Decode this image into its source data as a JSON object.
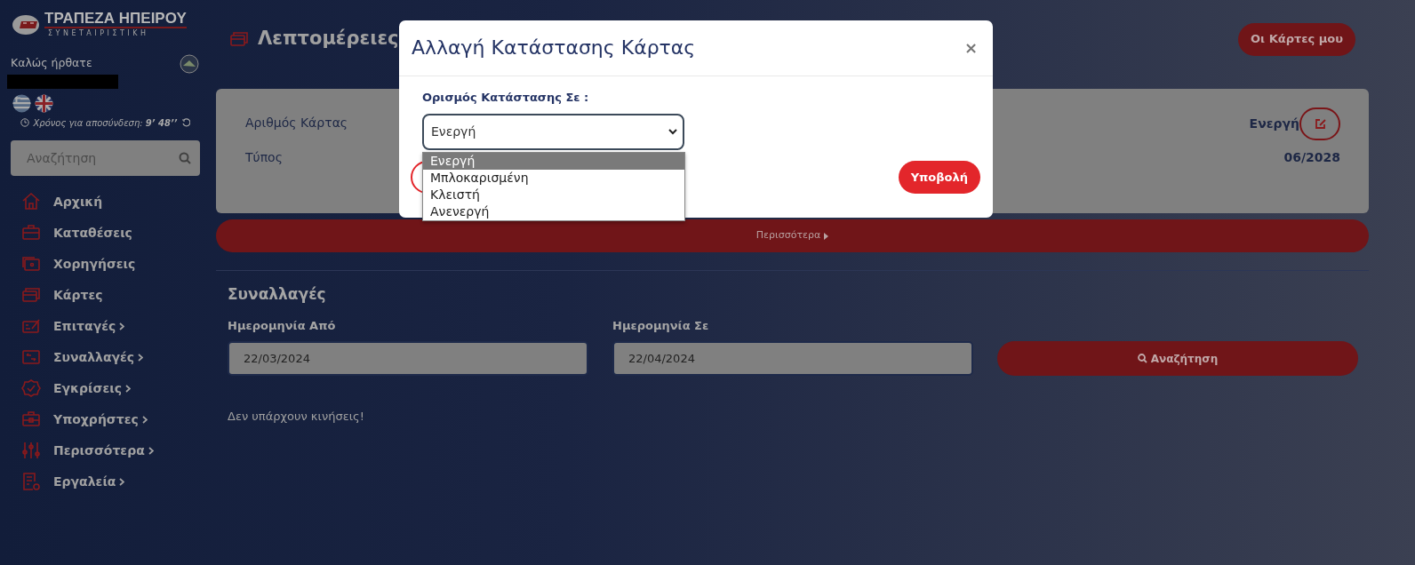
{
  "sidebar": {
    "logo": {
      "name": "ΤΡΑΠΕΖΑ ΗΠΕΙΡΟΥ",
      "tagline": "ΣΥΝΕΤΑΙΡΙΣΤΙΚΗ"
    },
    "welcome": "Καλώς ήρθατε",
    "session": "Χρόνος για αποσύνδεση: **9’ 48’’**",
    "search": {
      "placeholder": "Αναζήτηση"
    },
    "menu": [
      {
        "label": "Αρχική",
        "kind": "home",
        "submenu": false
      },
      {
        "label": "Καταθέσεις",
        "kind": "briefcase",
        "submenu": false
      },
      {
        "label": "Χορηγήσεις",
        "kind": "loan",
        "submenu": false
      },
      {
        "label": "Κάρτες",
        "kind": "cards",
        "submenu": false
      },
      {
        "label": "Επιταγές",
        "kind": "cheque",
        "submenu": true
      },
      {
        "label": "Συναλλαγές",
        "kind": "transfer",
        "submenu": true
      },
      {
        "label": "Εγκρίσεις",
        "kind": "badge",
        "submenu": true
      },
      {
        "label": "Υποχρήστες",
        "kind": "case",
        "submenu": true
      },
      {
        "label": "Περισσότερα",
        "kind": "sliders",
        "submenu": true
      },
      {
        "label": "Εργαλεία",
        "kind": "docgear",
        "submenu": true
      }
    ]
  },
  "main": {
    "title": "Λεπτομέρειες",
    "my_cards_button": "Οι Κάρτες μου",
    "card_details": {
      "fields": [
        {
          "label": "Αριθμός Κάρτας"
        },
        {
          "label": "Τύπος"
        }
      ],
      "status": "Ενεργή",
      "expiry": "06/2028"
    },
    "more_button": "Περισσότερα",
    "transactions": {
      "title": "Συναλλαγές",
      "date_from": {
        "label": "Ημερομηνία Από",
        "value": "22/03/2024"
      },
      "date_to": {
        "label": "Ημερομηνία Σε",
        "value": "22/04/2024"
      },
      "search_button": "Αναζήτηση",
      "empty_message": "Δεν υπάρχουν κινήσεις!"
    }
  },
  "modal": {
    "title": "Αλλαγή Κατάστασης Κάρτας",
    "close": "×",
    "field_label": "Ορισμός Κατάστασης Σε :",
    "select_value": "Ενεργή",
    "options": [
      {
        "label": "Ενεργή",
        "selected": true
      },
      {
        "label": "Μπλοκαρισμένη",
        "selected": false
      },
      {
        "label": "Κλειστή",
        "selected": false
      },
      {
        "label": "Ανενεργή",
        "selected": false
      }
    ],
    "submit_button": "Υποβολή"
  }
}
